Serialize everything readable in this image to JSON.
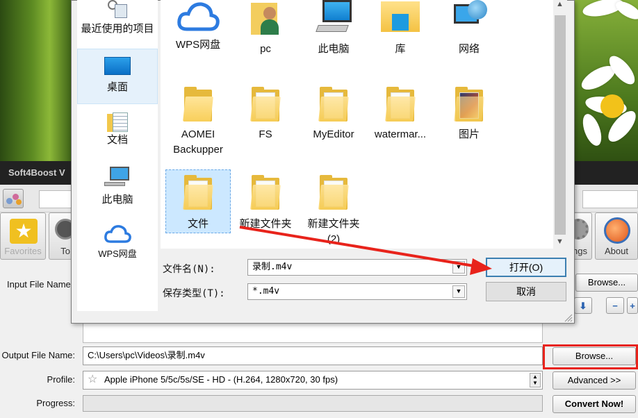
{
  "dialog": {
    "nav_items": [
      {
        "label": "最近使用的项目",
        "icon": "recent-items-icon"
      },
      {
        "label": "桌面",
        "icon": "desktop-icon"
      },
      {
        "label": "文档",
        "icon": "documents-icon"
      },
      {
        "label": "此电脑",
        "icon": "this-pc-icon"
      },
      {
        "label": "WPS网盘",
        "icon": "wps-cloud-icon"
      }
    ],
    "files_row1": [
      {
        "name": "WPS网盘",
        "icon": "wps-cloud-icon"
      },
      {
        "name": "pc",
        "icon": "user-folder-icon"
      },
      {
        "name": "此电脑",
        "icon": "computer-icon"
      },
      {
        "name": "库",
        "icon": "library-icon"
      },
      {
        "name": "网络",
        "icon": "network-icon"
      }
    ],
    "files_row2": [
      {
        "name": "AOMEI Backupper",
        "icon": "folder-icon"
      },
      {
        "name": "FS",
        "icon": "folder-icon"
      },
      {
        "name": "MyEditor",
        "icon": "folder-icon"
      },
      {
        "name": "watermar...",
        "icon": "folder-icon"
      },
      {
        "name": "图片",
        "icon": "folder-icon"
      }
    ],
    "files_row3": [
      {
        "name": "文件",
        "icon": "folder-icon",
        "selected": true
      },
      {
        "name": "新建文件夹",
        "icon": "folder-icon"
      },
      {
        "name": "新建文件夹 (2)",
        "icon": "folder-icon"
      }
    ],
    "filename_label": "文件名(N):",
    "filename_value": "录制.m4v",
    "filetype_label": "保存类型(T):",
    "filetype_value": "*.m4v",
    "open_label": "打开(O)",
    "cancel_label": "取消"
  },
  "app": {
    "title": "Soft4Boost V",
    "toolbar": {
      "favorites_label": "Favorites",
      "tools_label": "To",
      "settings_label": "ngs",
      "about_label": "About"
    },
    "input_file_label": "Input File Name",
    "input_browse_label": "Browse...",
    "output_file_label": "Output File Name:",
    "output_file_value": "C:\\Users\\pc\\Videos\\录制.m4v",
    "output_browse_label": "Browse...",
    "profile_label": "Profile:",
    "profile_value": "Apple iPhone 5/5c/5s/SE - HD - (H.264, 1280x720, 30 fps)",
    "advanced_label": "Advanced >>",
    "progress_label": "Progress:",
    "convert_label": "Convert Now!"
  },
  "colors": {
    "annotation_red": "#e8231b",
    "selection_blue": "#cce8ff",
    "folder_yellow": "#f8cf5a"
  }
}
